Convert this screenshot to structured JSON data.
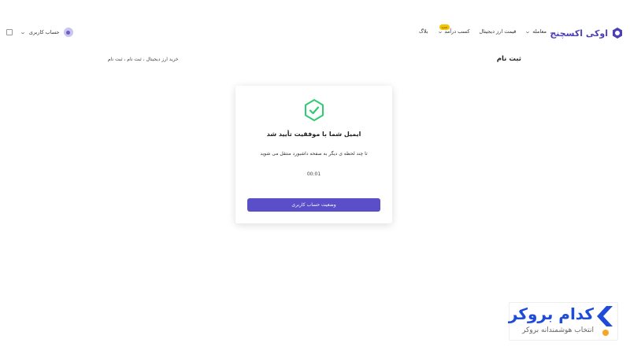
{
  "header": {
    "logo_text": "اوکی اکسچنج",
    "nav": [
      {
        "label": "معامله",
        "has_dropdown": true
      },
      {
        "label": "قیمت ارز دیجیتال",
        "has_dropdown": false
      },
      {
        "label": "کسب درآمد",
        "has_dropdown": true,
        "badge": "جدید"
      },
      {
        "label": "بلاگ",
        "has_dropdown": false
      }
    ],
    "account_label": "حساب کاربری"
  },
  "page": {
    "title": "ثبت نام",
    "breadcrumb": "خرید ارز دیجیتال ، ثبت نام ، ثبت نام"
  },
  "card": {
    "title": "ایمیل شما با موفقیت تأیید شد",
    "description": "تا چند لحظه ی دیگر به صفحه داشبورد منتقل می شوید",
    "timer": "00:01",
    "button_label": "وضعیت حساب کاربری"
  },
  "ad": {
    "title": "کدام بروکر",
    "subtitle": "انتخاب هوشمندانه بروکر"
  },
  "colors": {
    "brand": "#5a4ec9",
    "success": "#2ecc71",
    "ad_blue": "#1e4bd8",
    "ad_orange": "#f5a623"
  }
}
